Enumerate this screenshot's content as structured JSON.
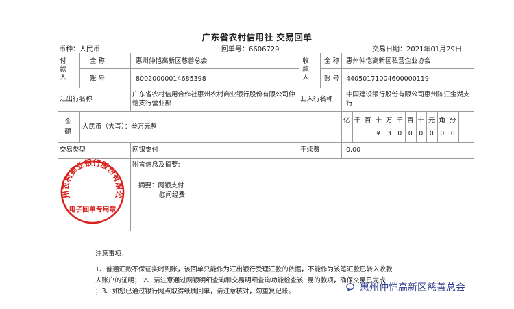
{
  "title": "广东省农村信用社 交易回单",
  "currency_label": "币种：人民币",
  "receipt_no": "回单号：6606729",
  "trade_date": "交易日期：2021年01月29日",
  "payer": {
    "side_label": [
      "付",
      "款",
      "人"
    ],
    "name_label": "全 称",
    "name": "惠州仲恺高新区慈善总会",
    "account_label": "账 号",
    "account": "80020000014685398"
  },
  "payee": {
    "side_label": [
      "收",
      "款",
      "人"
    ],
    "name_label": "全 称",
    "name": "惠州仲恺高新区私营企业协会",
    "account_label": "账 号",
    "account": "44050171004600000119"
  },
  "remit_out_bank_label": "汇出行名称",
  "remit_out_bank": "广东省农村信用合作社惠州农村商业银行股份有限公司仲恺支行营业部",
  "remit_in_bank_label": "汇入行名称",
  "remit_in_bank": "中国建设银行股份有限公司惠州陈江金湖支行",
  "amount": {
    "side_label": [
      "金",
      "额"
    ],
    "words": "人民币（大写）：叁万元整",
    "units": [
      "亿",
      "千",
      "百",
      "十",
      "万",
      "千",
      "百",
      "十",
      "元",
      "角",
      "分"
    ],
    "digits": [
      "",
      "",
      "",
      "¥",
      "3",
      "0",
      "0",
      "0",
      "0",
      "0",
      "0"
    ]
  },
  "trade_type_label": "交易类型",
  "trade_type": "网银支付",
  "fee_label": "手续费",
  "fee": "0.00",
  "memo_label": "附言信息及摘要:",
  "memo_line1": "摘要：网银支付",
  "memo_line2": "慰问经费",
  "stamp": {
    "top_text": "惠州农村商业银行股份有限公司",
    "bottom_text": "电子回单专用章",
    "color": "#d9221c"
  },
  "notes_title": "注意事项：",
  "notes_lines": [
    "1、普通汇款不保证实时到账，该回单只能作为汇出银行受理汇款的依据，不能作为该笔汇款已转入收款",
    "人账户的证明；  2、请注意通过网银明细查询和交易明细查询功能检查该··易的款项，确保交易已完成",
    "；3、如您已通过银行网点取得纸质回单，请注意核对，勿重复记账。"
  ],
  "watermark": "惠州仲恺高新区慈善总会"
}
